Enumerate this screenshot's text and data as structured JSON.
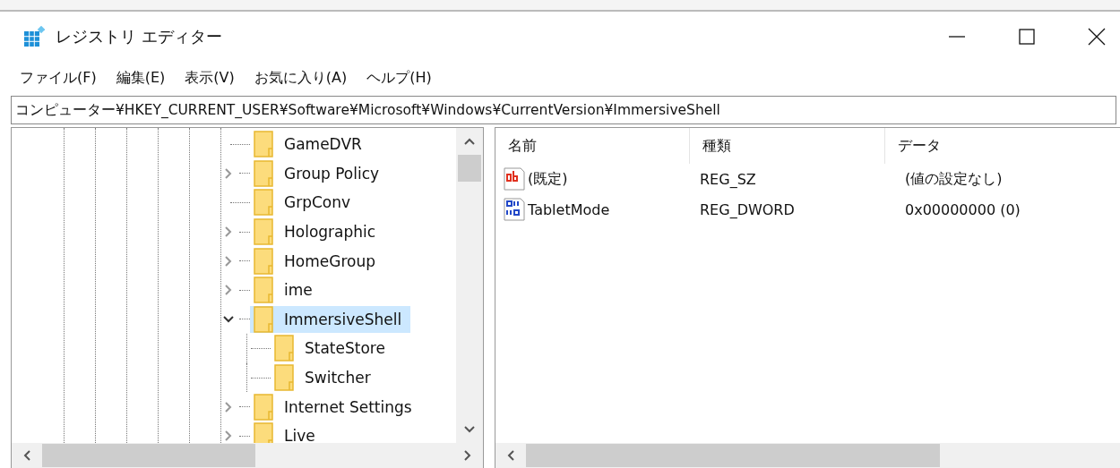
{
  "window": {
    "title": "レジストリ エディター"
  },
  "menu": [
    "ファイル(F)",
    "編集(E)",
    "表示(V)",
    "お気に入り(A)",
    "ヘルプ(H)"
  ],
  "address": "コンピューター¥HKEY_CURRENT_USER¥Software¥Microsoft¥Windows¥CurrentVersion¥ImmersiveShell",
  "tree": [
    {
      "kind": "leaf",
      "name": "GameDVR",
      "selected": false
    },
    {
      "kind": "branch",
      "name": "Group Policy",
      "expanded": false,
      "selected": false
    },
    {
      "kind": "leaf",
      "name": "GrpConv",
      "selected": false
    },
    {
      "kind": "branch",
      "name": "Holographic",
      "expanded": false,
      "selected": false
    },
    {
      "kind": "branch",
      "name": "HomeGroup",
      "expanded": false,
      "selected": false
    },
    {
      "kind": "branch",
      "name": "ime",
      "expanded": false,
      "selected": false
    },
    {
      "kind": "branch",
      "name": "ImmersiveShell",
      "expanded": true,
      "selected": true,
      "children": [
        {
          "kind": "leaf",
          "name": "StateStore",
          "selected": false
        },
        {
          "kind": "leaf",
          "name": "Switcher",
          "selected": false
        }
      ]
    },
    {
      "kind": "branch",
      "name": "Internet Settings",
      "expanded": false,
      "selected": false
    },
    {
      "kind": "branch",
      "name": "Live",
      "expanded": false,
      "selected": false
    }
  ],
  "table": {
    "columns": [
      "名前",
      "種類",
      "データ"
    ],
    "rows": [
      {
        "kind": "string",
        "name": "(既定)",
        "type": "REG_SZ",
        "data": "(値の設定なし)"
      },
      {
        "kind": "binary",
        "name": "TabletMode",
        "type": "REG_DWORD",
        "data": "0x00000000 (0)"
      }
    ]
  }
}
